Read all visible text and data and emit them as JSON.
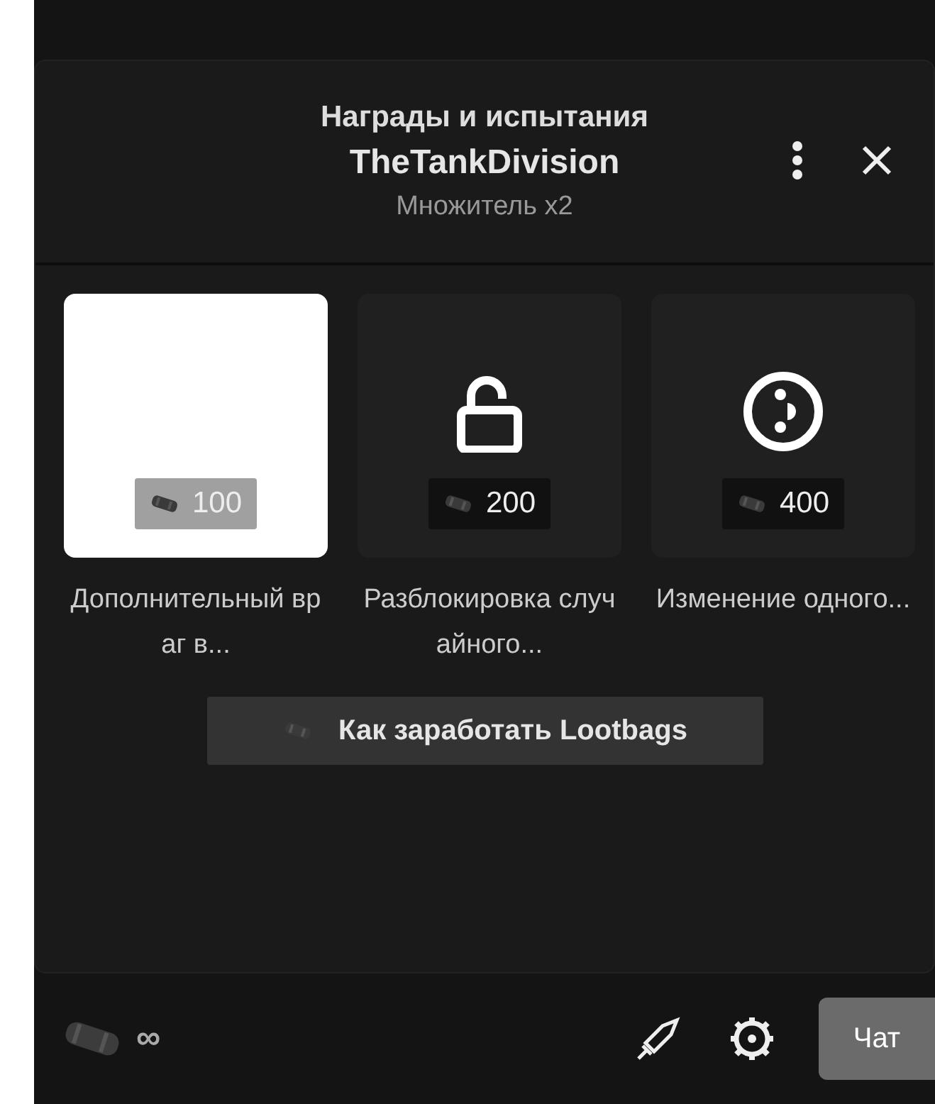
{
  "header": {
    "title": "Награды и испытания",
    "channel": "TheTankDivision",
    "subtitle": "Множитель x2"
  },
  "rewards": [
    {
      "kind": "blank",
      "price": "100",
      "label": "Дополнительный враг в...",
      "selected": true
    },
    {
      "kind": "lock",
      "price": "200",
      "label": "Разблокировка случайного...",
      "selected": false
    },
    {
      "kind": "dice",
      "price": "400",
      "label": "Изменение одного...",
      "selected": false
    }
  ],
  "earn_button": "Как заработать Lootbags",
  "footer": {
    "balance": "∞",
    "chat_button": "Чат"
  }
}
